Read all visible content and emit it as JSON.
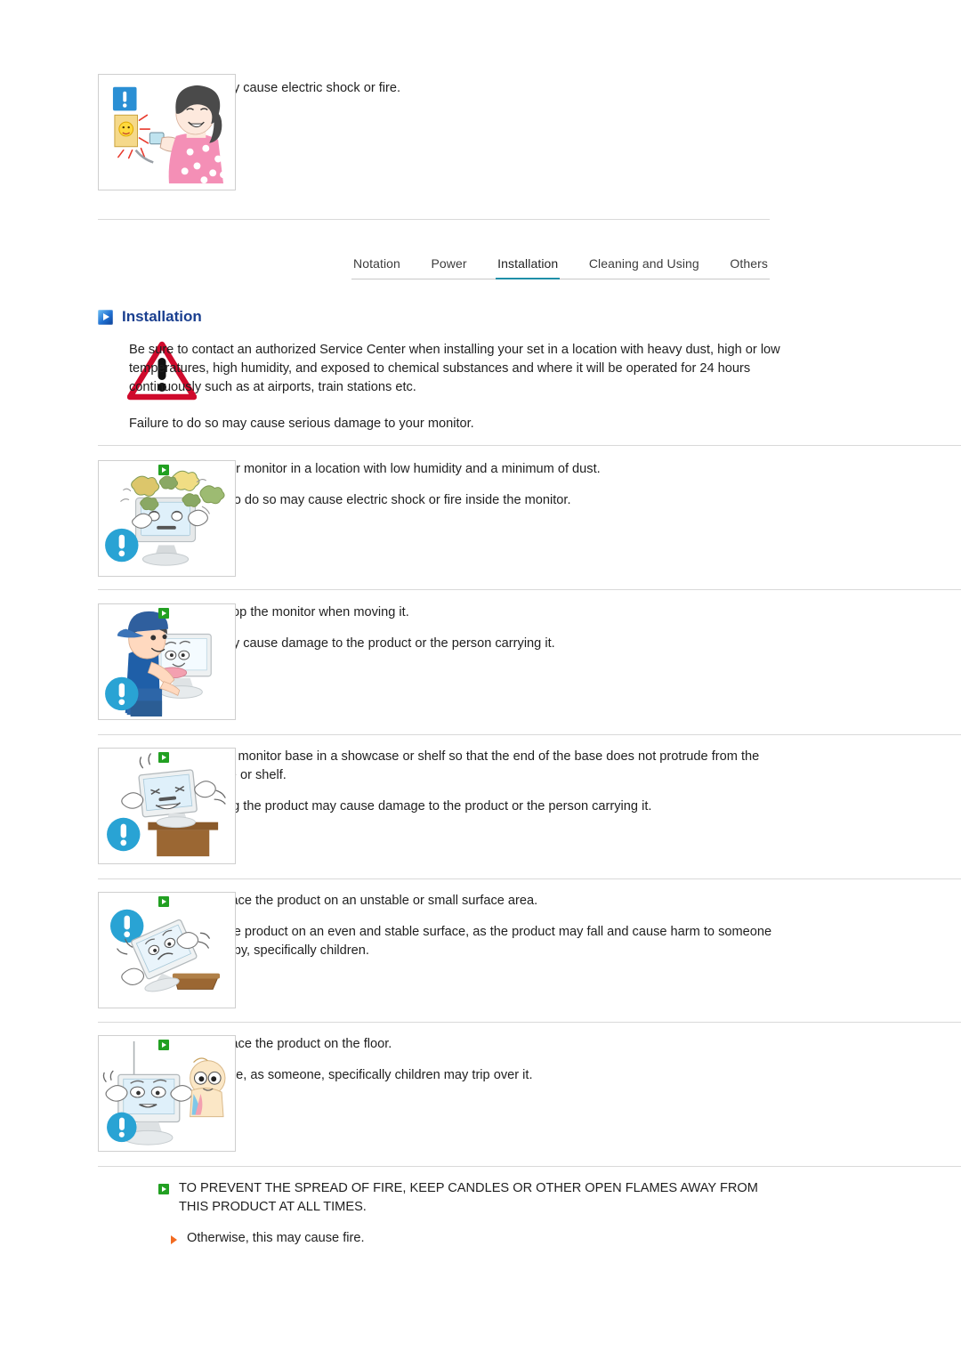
{
  "heading": {
    "icon": "blue-arrow-icon",
    "title": "Installation"
  },
  "tabs": [
    {
      "label": "Notation",
      "active": false
    },
    {
      "label": "Power",
      "active": false
    },
    {
      "label": "Installation",
      "active": true
    },
    {
      "label": "Cleaning and Using",
      "active": false
    },
    {
      "label": "Others",
      "active": false
    }
  ],
  "colors": {
    "heading_blue": "#1a3f8f",
    "tab_active_underline": "#1f8fa8",
    "green_bullet": "#22a022",
    "orange_bullet": "#f26b21",
    "warning_red": "#cf0a2c",
    "info_blue": "#29a3d4",
    "divider": "#d9d9d9"
  },
  "top_note": {
    "text": "This may cause electric shock or fire.",
    "illustration": "woman-plugging-sparking-outlet"
  },
  "warning": {
    "illustration": "red-warning-triangle",
    "paragraph1": "Be sure to contact an authorized Service Center when installing your set in a location with heavy dust, high or low temperatures, high humidity, and exposed to chemical substances and where it will be operated for 24 hours continuously such as at airports, train stations etc.",
    "paragraph2": "Failure to do so may cause serious damage to your monitor."
  },
  "sections": [
    {
      "illustration": "monitor-surrounded-by-dust",
      "main": "Place your monitor in a location with low humidity and a minimum of dust.",
      "sub": "Failure to do so may cause electric shock or fire inside the monitor."
    },
    {
      "illustration": "man-carrying-monitor",
      "main": "Do not drop the monitor when moving it.",
      "sub": "This may cause damage to the product or the person carrying it."
    },
    {
      "illustration": "monitor-on-shelf-edge",
      "main": "Install the monitor base in a showcase or shelf so that the end of the base does not protrude from the showcase or shelf.",
      "sub": "Dropping the product may cause damage to the product or the person carrying it."
    },
    {
      "illustration": "monitor-falling-off-small-surface",
      "main": "Do not place the product on an unstable or small surface area.",
      "sub": "Place the product on an even and stable surface, as the product may fall and cause harm to someone walking by, specifically children."
    },
    {
      "illustration": "monitor-on-floor-with-child",
      "main": "Do not place the product on the floor.",
      "sub": "Take care, as someone, specifically children may trip over it."
    }
  ],
  "final_section": {
    "main": "TO PREVENT THE SPREAD OF FIRE, KEEP CANDLES OR OTHER OPEN FLAMES AWAY FROM THIS PRODUCT AT ALL TIMES.",
    "sub": "Otherwise, this may cause fire."
  }
}
